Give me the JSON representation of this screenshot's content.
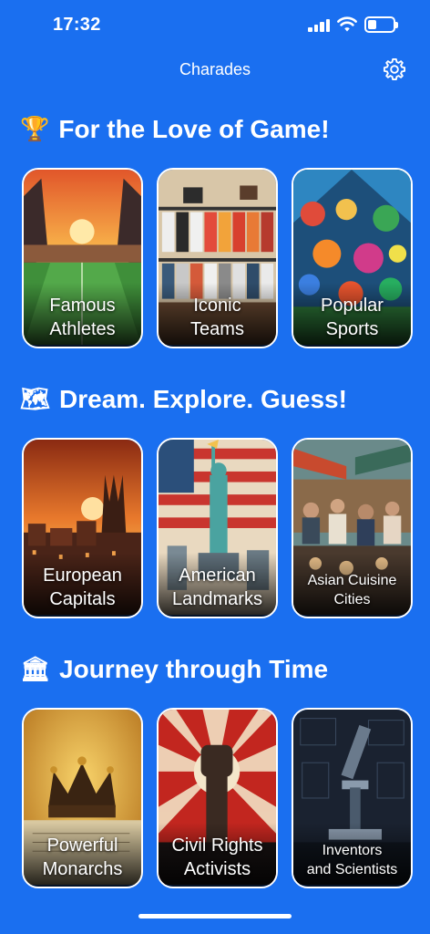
{
  "status": {
    "time": "17:32"
  },
  "nav": {
    "title": "Charades"
  },
  "sections": [
    {
      "emoji": "🏆",
      "title": "For the Love of Game!",
      "cards": [
        {
          "line1": "Famous",
          "line2": "Athletes"
        },
        {
          "line1": "Iconic",
          "line2": "Teams"
        },
        {
          "line1": "Popular",
          "line2": "Sports"
        }
      ]
    },
    {
      "emoji": "🗺",
      "title": "Dream. Explore. Guess!",
      "cards": [
        {
          "line1": "European",
          "line2": "Capitals"
        },
        {
          "line1": "American",
          "line2": "Landmarks"
        },
        {
          "line1": "Asian Cuisine",
          "line2": "Cities"
        }
      ]
    },
    {
      "emoji": "🏛",
      "title": "Journey through Time",
      "cards": [
        {
          "line1": "Powerful",
          "line2": "Monarchs"
        },
        {
          "line1": "Civil Rights",
          "line2": "Activists"
        },
        {
          "line1": "Inventors",
          "line2": "and Scientists"
        }
      ]
    }
  ],
  "colors": {
    "background": "#1a6ff0",
    "card_border": "#ffffff"
  },
  "icons": {
    "settings": "gear-icon"
  }
}
